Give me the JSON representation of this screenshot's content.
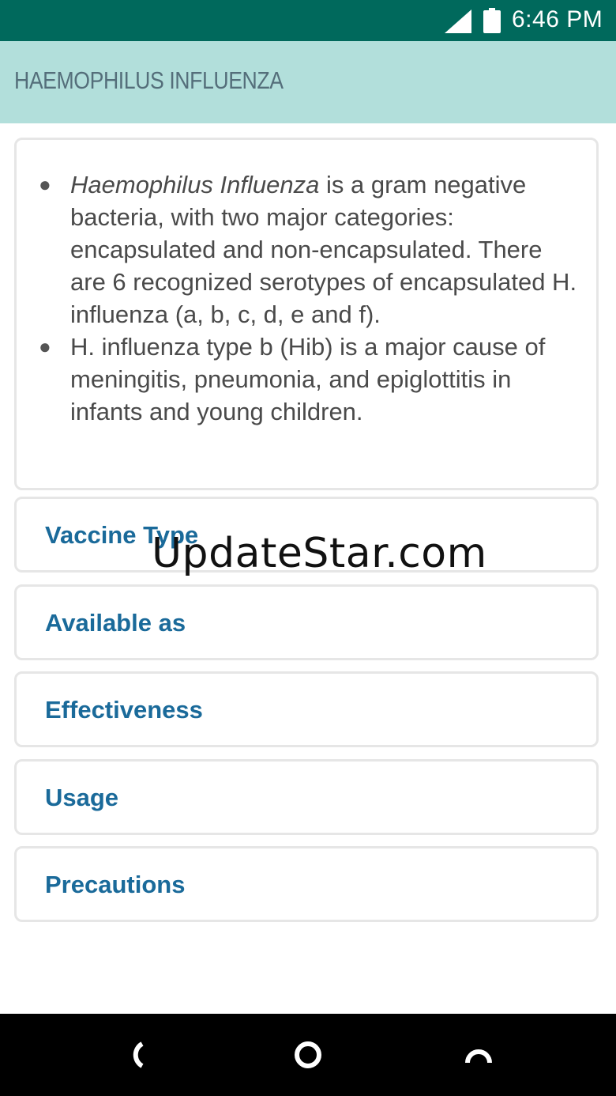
{
  "status_bar": {
    "time": "6:46 PM",
    "icons": [
      "signal-icon",
      "battery-icon"
    ]
  },
  "app_bar": {
    "title": "HAEMOPHILUS INFLUENZA"
  },
  "intro": {
    "bullets": [
      {
        "italic": "Haemophilus Influenza",
        "text": " is a gram negative bacteria, with two major categories: encapsulated and non-encapsulated. There are 6 recognized serotypes of encapsulated H. influenza (a, b, c, d, e and f)."
      },
      {
        "italic": "",
        "text": "H. influenza type b (Hib) is a major cause of meningitis, pneumonia, and epiglottitis in infants and young children."
      }
    ]
  },
  "sections": [
    {
      "label": "Vaccine Type"
    },
    {
      "label": "Available as"
    },
    {
      "label": "Effectiveness"
    },
    {
      "label": "Usage"
    },
    {
      "label": "Precautions"
    }
  ],
  "watermark": "UpdateStar.com",
  "nav_bar": {
    "icons": [
      "back-icon",
      "home-icon",
      "recents-icon"
    ]
  },
  "colors": {
    "status_bar": "#00695c",
    "app_bar": "#b2dfdb",
    "title_text": "#546e7a",
    "section_label": "#1a6a9a",
    "card_border": "#e6e6e6"
  }
}
